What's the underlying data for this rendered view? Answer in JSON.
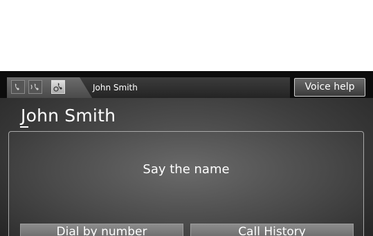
{
  "topbar": {
    "status_icons": [
      {
        "icon": "phone-signal-icon",
        "active": false
      },
      {
        "icon": "phone-voice-icon",
        "active": false
      },
      {
        "icon": "phone-talk-icon",
        "active": true
      }
    ],
    "tab_label": "John Smith",
    "voice_help_label": "Voice help"
  },
  "main": {
    "title": "John Smith",
    "prompt": "Say the name",
    "buttons": [
      {
        "label": "Dial by number"
      },
      {
        "label": "Call History"
      }
    ]
  }
}
